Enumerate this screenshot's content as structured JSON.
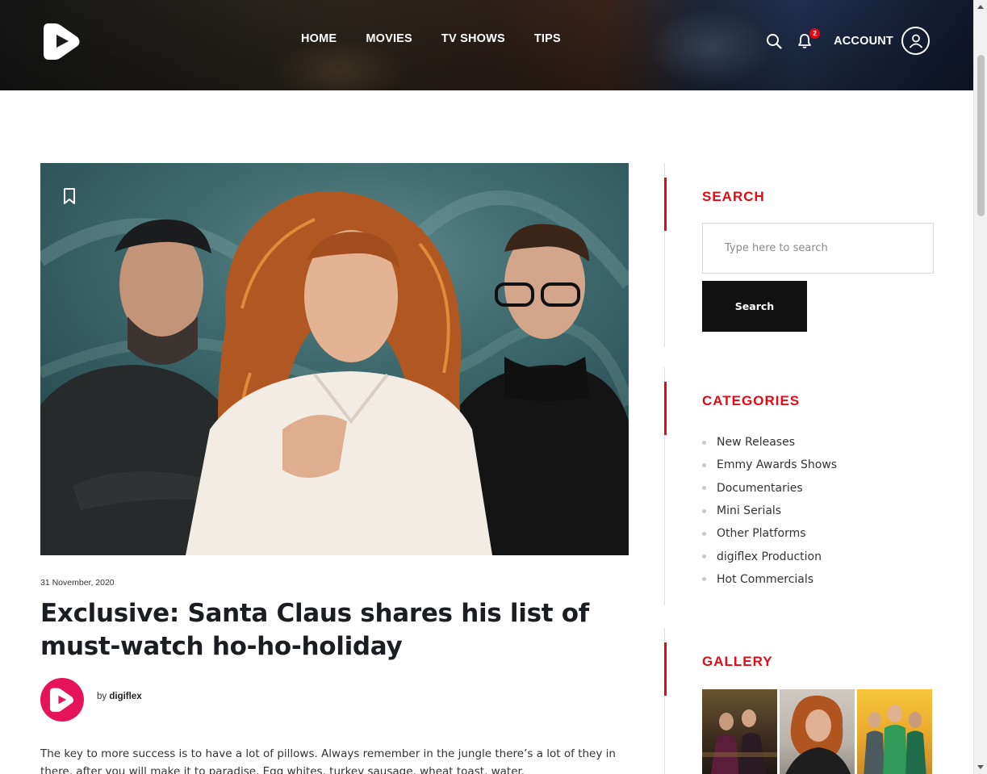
{
  "header": {
    "nav": [
      "HOME",
      "MOVIES",
      "TV SHOWS",
      "TIPS"
    ],
    "notification_count": "2",
    "account_label": "ACCOUNT"
  },
  "post": {
    "date": "31 November, 2020",
    "title": "Exclusive: Santa Claus shares his list of must-watch ho-ho-holiday",
    "by_label": "by",
    "author": "digiflex",
    "body": "The key to more success is to have a lot of pillows. Always remember in the jungle there’s a lot of they in there, after you will make it to paradise. Egg whites, turkey sausage, wheat toast, water."
  },
  "sidebar": {
    "search": {
      "title": "SEARCH",
      "placeholder": "Type here to search",
      "value": "",
      "button_label": "Search"
    },
    "categories": {
      "title": "CATEGORIES",
      "items": [
        "New Releases",
        "Emmy Awards Shows",
        "Documentaries",
        "Mini Serials",
        "Other Platforms",
        "digiflex Production",
        "Hot Commercials"
      ]
    },
    "gallery": {
      "title": "GALLERY",
      "count": 3
    }
  },
  "colors": {
    "accent": "#e50914",
    "author_avatar": "#e5145a",
    "button_dark": "#111111"
  },
  "icons": [
    "play-logo-icon",
    "search-icon",
    "bell-icon",
    "user-icon",
    "bookmark-icon"
  ]
}
